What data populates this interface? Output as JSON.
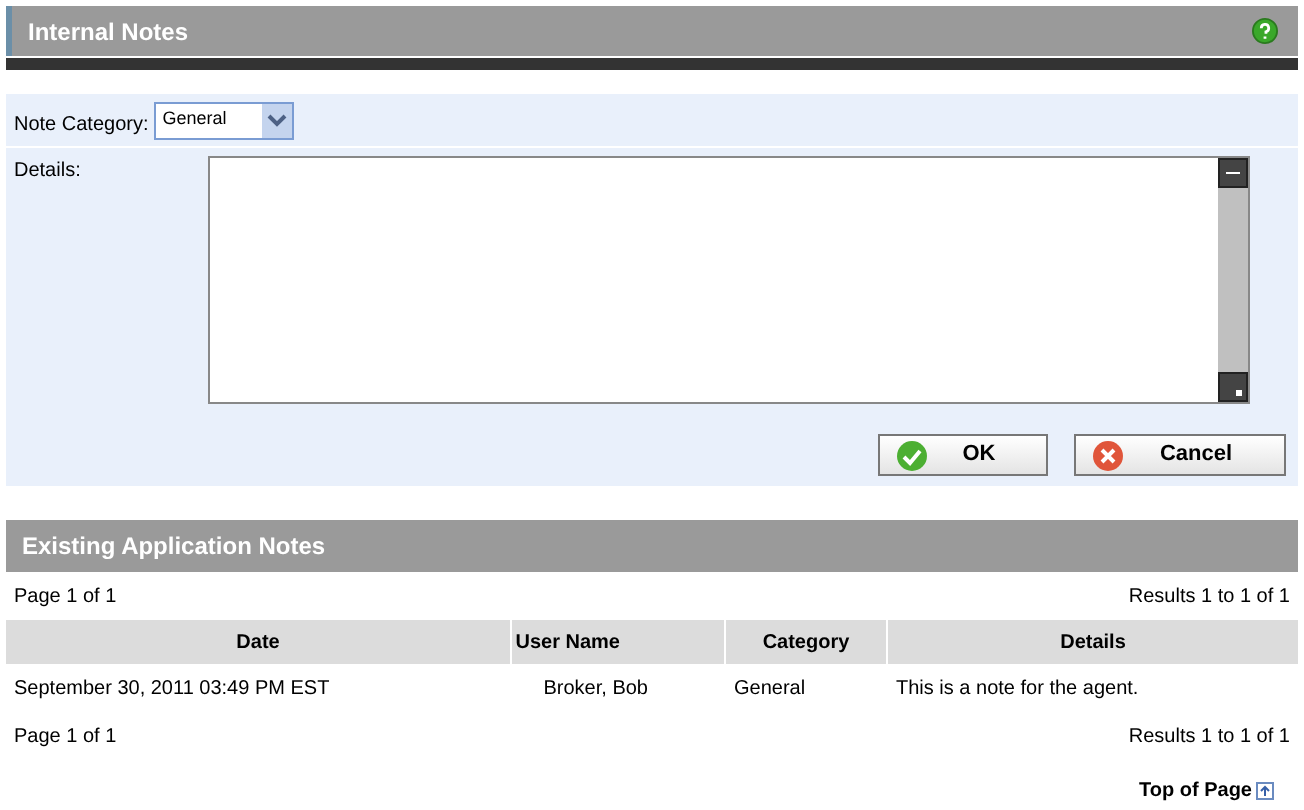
{
  "header": {
    "title": "Internal Notes"
  },
  "form": {
    "category_label": "Note Category:",
    "category_value": "General",
    "details_label": "Details:",
    "buttons": [
      {
        "kind": "ok",
        "label": "OK"
      },
      {
        "kind": "cancel",
        "label": "Cancel"
      }
    ]
  },
  "notes": {
    "title": "Existing Application Notes",
    "pager_top": {
      "page": "Page 1 of 1",
      "results": "Results 1 to 1 of 1"
    },
    "columns": [
      "Date",
      "User Name",
      "Category",
      "Details"
    ],
    "rows": [
      [
        "September 30, 2011 03:49 PM EST",
        "Broker, Bob",
        "General",
        "This is a note for the agent."
      ]
    ],
    "pager_bottom": {
      "page": "Page 1 of 1",
      "results": "Results 1 to 1 of 1"
    },
    "top_link": "Top of Page"
  }
}
